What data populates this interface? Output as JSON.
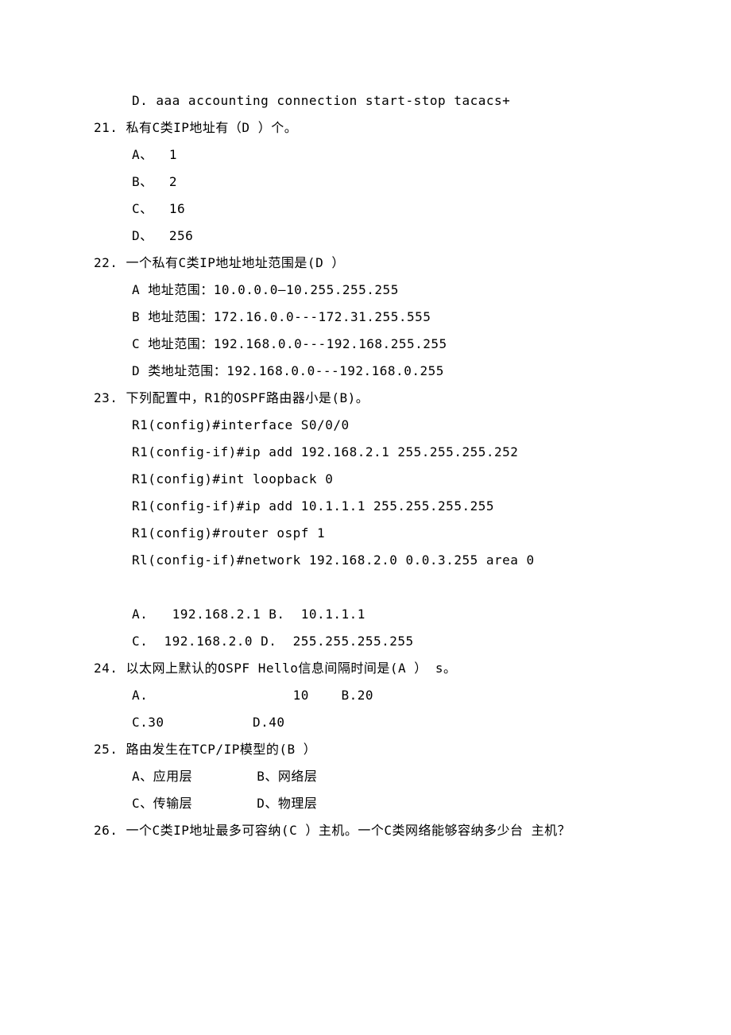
{
  "lines": [
    {
      "cls": "indent-opt",
      "text": "D. aaa accounting connection start-stop tacacs+"
    },
    {
      "cls": "indent-q",
      "text": "21. 私有C类IP地址有（D ）个。"
    },
    {
      "cls": "indent-opt",
      "text": "A、  1"
    },
    {
      "cls": "indent-opt",
      "text": "B、  2"
    },
    {
      "cls": "indent-opt",
      "text": "C、  16"
    },
    {
      "cls": "indent-opt",
      "text": "D、  256"
    },
    {
      "cls": "indent-q",
      "text": "22. 一个私有C类IP地址地址范围是(D ）"
    },
    {
      "cls": "indent-opt",
      "text": "A 地址范围：10.0.0.0—10.255.255.255"
    },
    {
      "cls": "indent-opt",
      "text": "B 地址范围：172.16.0.0---172.31.255.555"
    },
    {
      "cls": "indent-opt",
      "text": "C 地址范围：192.168.0.0---192.168.255.255"
    },
    {
      "cls": "indent-opt",
      "text": "D 类地址范围：192.168.0.0---192.168.0.255"
    },
    {
      "cls": "indent-q",
      "text": "23. 下列配置中，R1的OSPF路由器小是(B)。"
    },
    {
      "cls": "indent-opt",
      "text": "R1(config)#interface S0/0/0"
    },
    {
      "cls": "indent-opt",
      "text": "R1(config-if)#ip add 192.168.2.1 255.255.255.252"
    },
    {
      "cls": "indent-opt",
      "text": "R1(config)#int loopback 0"
    },
    {
      "cls": "indent-opt",
      "text": "R1(config-if)#ip add 10.1.1.1 255.255.255.255"
    },
    {
      "cls": "indent-opt",
      "text": "R1(config)#router ospf 1"
    },
    {
      "cls": "indent-opt",
      "text": "Rl(config-if)#network 192.168.2.0 0.0.3.255 area 0"
    },
    {
      "cls": "gap",
      "text": ""
    },
    {
      "cls": "indent-opt",
      "text": "A.   192.168.2.1 B.  10.1.1.1"
    },
    {
      "cls": "indent-opt",
      "text": "C.  192.168.2.0 D.  255.255.255.255"
    },
    {
      "cls": "indent-q",
      "text": "24. 以太网上默认的OSPF Hello信息间隔时间是(A ） s。"
    },
    {
      "cls": "indent-opt",
      "text": "A.                  10    B.20"
    },
    {
      "cls": "indent-opt",
      "text": "C.30           D.40"
    },
    {
      "cls": "indent-q",
      "text": "25. 路由发生在TCP/IP模型的(B ）"
    },
    {
      "cls": "indent-opt",
      "text": "A、应用层        B、网络层"
    },
    {
      "cls": "indent-opt",
      "text": "C、传输层        D、物理层"
    },
    {
      "cls": "indent-q",
      "text": "26. 一个C类IP地址最多可容纳(C ）主机。一个C类网络能够容纳多少台 主机？"
    }
  ]
}
